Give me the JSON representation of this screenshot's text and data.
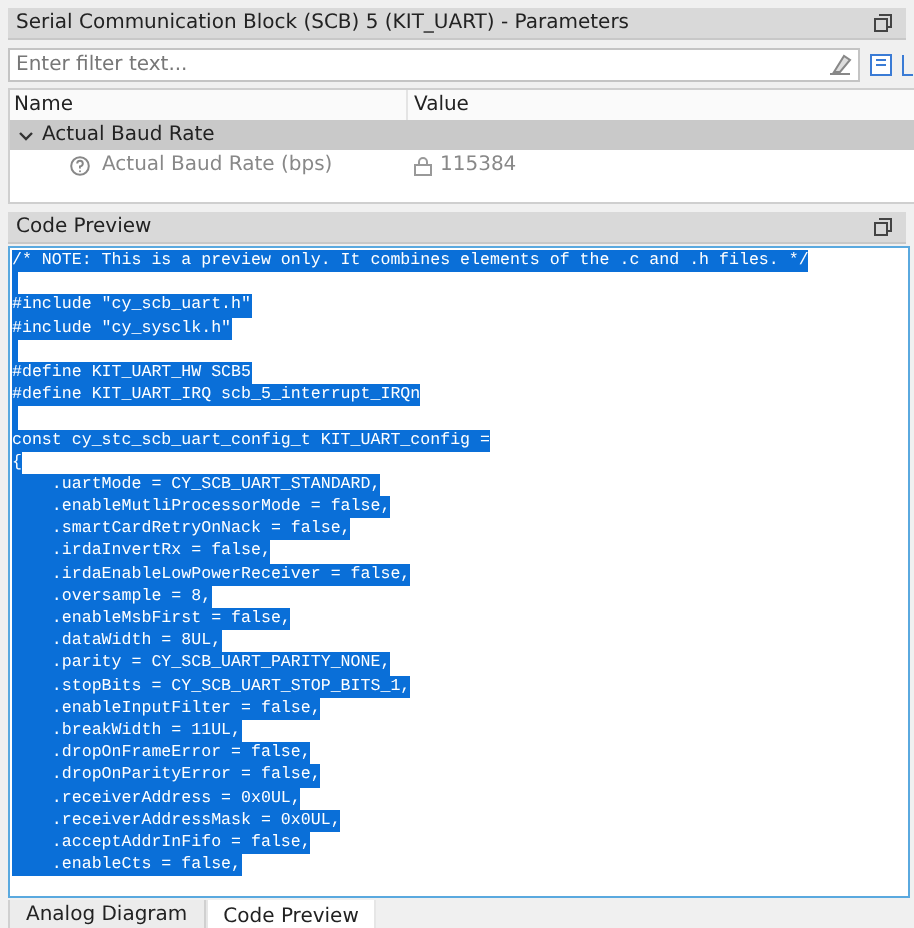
{
  "parameters_panel": {
    "title": "Serial Communication Block (SCB) 5 (KIT_UART) - Parameters",
    "filter": {
      "placeholder": "Enter filter text..."
    },
    "columns": [
      "Name",
      "Value"
    ],
    "groups": [
      {
        "label": "Actual Baud Rate",
        "expanded": true,
        "children": [
          {
            "name": "Actual Baud Rate (bps)",
            "value": "115384"
          }
        ]
      }
    ]
  },
  "code_panel": {
    "title": "Code Preview",
    "all_selected": true,
    "lines": [
      {
        "kind": "code",
        "text": "/* NOTE: This is a preview only. It combines elements of the .c and .h files. */"
      },
      {
        "kind": "blank"
      },
      {
        "kind": "code",
        "text": "#include \"cy_scb_uart.h\""
      },
      {
        "kind": "code",
        "text": "#include \"cy_sysclk.h\""
      },
      {
        "kind": "blank"
      },
      {
        "kind": "code",
        "text": "#define KIT_UART_HW SCB5"
      },
      {
        "kind": "code",
        "text": "#define KIT_UART_IRQ scb_5_interrupt_IRQn"
      },
      {
        "kind": "blank"
      },
      {
        "kind": "code",
        "text": "const cy_stc_scb_uart_config_t KIT_UART_config ="
      },
      {
        "kind": "code",
        "text": "{"
      },
      {
        "kind": "code",
        "text": "    .uartMode = CY_SCB_UART_STANDARD,"
      },
      {
        "kind": "code",
        "text": "    .enableMutliProcessorMode = false,"
      },
      {
        "kind": "code",
        "text": "    .smartCardRetryOnNack = false,"
      },
      {
        "kind": "code",
        "text": "    .irdaInvertRx = false,"
      },
      {
        "kind": "code",
        "text": "    .irdaEnableLowPowerReceiver = false,"
      },
      {
        "kind": "code",
        "text": "    .oversample = 8,"
      },
      {
        "kind": "code",
        "text": "    .enableMsbFirst = false,"
      },
      {
        "kind": "code",
        "text": "    .dataWidth = 8UL,"
      },
      {
        "kind": "code",
        "text": "    .parity = CY_SCB_UART_PARITY_NONE,"
      },
      {
        "kind": "code",
        "text": "    .stopBits = CY_SCB_UART_STOP_BITS_1,"
      },
      {
        "kind": "code",
        "text": "    .enableInputFilter = false,"
      },
      {
        "kind": "code",
        "text": "    .breakWidth = 11UL,"
      },
      {
        "kind": "code",
        "text": "    .dropOnFrameError = false,"
      },
      {
        "kind": "code",
        "text": "    .dropOnParityError = false,"
      },
      {
        "kind": "code",
        "text": "    .receiverAddress = 0x0UL,"
      },
      {
        "kind": "code",
        "text": "    .receiverAddressMask = 0x0UL,"
      },
      {
        "kind": "code",
        "text": "    .acceptAddrInFifo = false,"
      },
      {
        "kind": "code",
        "text": "    .enableCts = false,"
      }
    ]
  },
  "tabs": [
    {
      "label": "Analog Diagram",
      "selected": false
    },
    {
      "label": "Code Preview",
      "selected": true
    }
  ]
}
